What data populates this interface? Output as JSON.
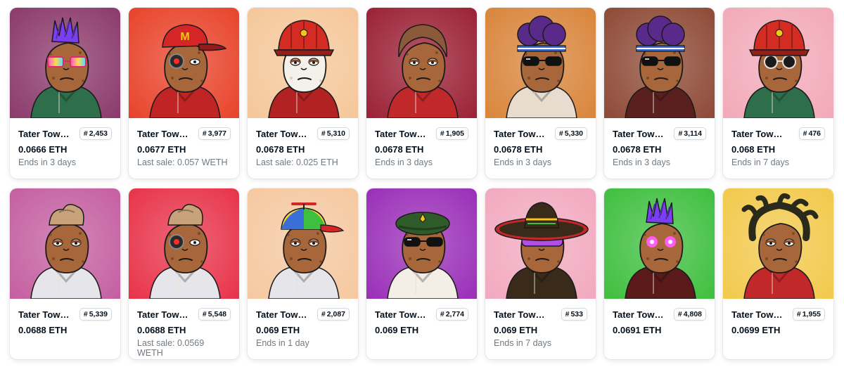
{
  "cards": [
    {
      "name": "Tater Town ...",
      "token": "2,453",
      "price": "0.0666 ETH",
      "sub": "Ends in 3 days",
      "bg": "#8b3a6b",
      "hat": "mohawk",
      "hat_color": "#7b3ff2",
      "glasses": "rainbow",
      "shirt": "#2f6e4a"
    },
    {
      "name": "Tater Town ...",
      "token": "3,977",
      "price": "0.0677 ETH",
      "sub": "Last sale: 0.057 WETH",
      "bg": "#e8432a",
      "hat": "cap",
      "hat_color": "#d42626",
      "glasses": "cyborg",
      "shirt": "#c02424"
    },
    {
      "name": "Tater Town ...",
      "token": "5,310",
      "price": "0.0678 ETH",
      "sub": "Last sale: 0.025 ETH",
      "bg": "#f5c79a",
      "hat": "fireman",
      "hat_color": "#d42c22",
      "glasses": "none",
      "shirt": "#b22222"
    },
    {
      "name": "Tater Town ...",
      "token": "1,905",
      "price": "0.0678 ETH",
      "sub": "Ends in 3 days",
      "bg": "#9b2136",
      "hat": "hair",
      "hat_color": "#8a5a3a",
      "glasses": "none",
      "shirt": "#c0282a"
    },
    {
      "name": "Tater Town ...",
      "token": "5,330",
      "price": "0.0678 ETH",
      "sub": "Ends in 3 days",
      "bg": "#d9853b",
      "hat": "afro",
      "hat_color": "#5a2a8a",
      "glasses": "shades",
      "shirt": "#e8dccf"
    },
    {
      "name": "Tater Town #...",
      "token": "3,114",
      "price": "0.0678 ETH",
      "sub": "Ends in 3 days",
      "bg": "#8e4a36",
      "hat": "afro",
      "hat_color": "#5a2a8a",
      "glasses": "shades",
      "shirt": "#5a2020"
    },
    {
      "name": "Tater Town #...",
      "token": "476",
      "price": "0.068 ETH",
      "sub": "Ends in 7 days",
      "bg": "#f2a9b8",
      "hat": "fireman",
      "hat_color": "#d42c22",
      "glasses": "round",
      "shirt": "#2f6e4a"
    },
    {
      "name": "Tater Town ...",
      "token": "5,339",
      "price": "0.0688 ETH",
      "sub": "",
      "bg": "#c45fa0",
      "hat": "bag",
      "hat_color": "#c8a27a",
      "glasses": "none",
      "shirt": "#e6e6ea"
    },
    {
      "name": "Tater Town ...",
      "token": "5,548",
      "price": "0.0688 ETH",
      "sub": "Last sale: 0.0569 WETH",
      "bg": "#e8334a",
      "hat": "bag",
      "hat_color": "#c8a27a",
      "glasses": "cyborg",
      "shirt": "#e6e6ea"
    },
    {
      "name": "Tater Town ...",
      "token": "2,087",
      "price": "0.069 ETH",
      "sub": "Ends in 1 day",
      "bg": "#f5c8a0",
      "hat": "propeller",
      "hat_color": "#3a6fd8",
      "glasses": "none",
      "shirt": "#e6e6ea"
    },
    {
      "name": "Tater Town ...",
      "token": "2,774",
      "price": "0.069 ETH",
      "sub": "",
      "bg": "#9a2fb8",
      "hat": "beret",
      "hat_color": "#2f5a2a",
      "glasses": "shades",
      "shirt": "#f4efe6"
    },
    {
      "name": "Tater Town #...",
      "token": "533",
      "price": "0.069 ETH",
      "sub": "Ends in 7 days",
      "bg": "#f2a9c0",
      "hat": "sombrero",
      "hat_color": "#3a2a1a",
      "glasses": "visor",
      "shirt": "#3a2a1a"
    },
    {
      "name": "Tater Town ...",
      "token": "4,808",
      "price": "0.0691 ETH",
      "sub": "",
      "bg": "#3fbf3f",
      "hat": "mohawk",
      "hat_color": "#7b3ff2",
      "glasses": "laser",
      "shirt": "#5a1a1a"
    },
    {
      "name": "Tater Town ...",
      "token": "1,955",
      "price": "0.0699 ETH",
      "sub": "",
      "bg": "#f2c94c",
      "hat": "dreads",
      "hat_color": "#2a2a1a",
      "glasses": "none",
      "shirt": "#c0282a"
    }
  ]
}
